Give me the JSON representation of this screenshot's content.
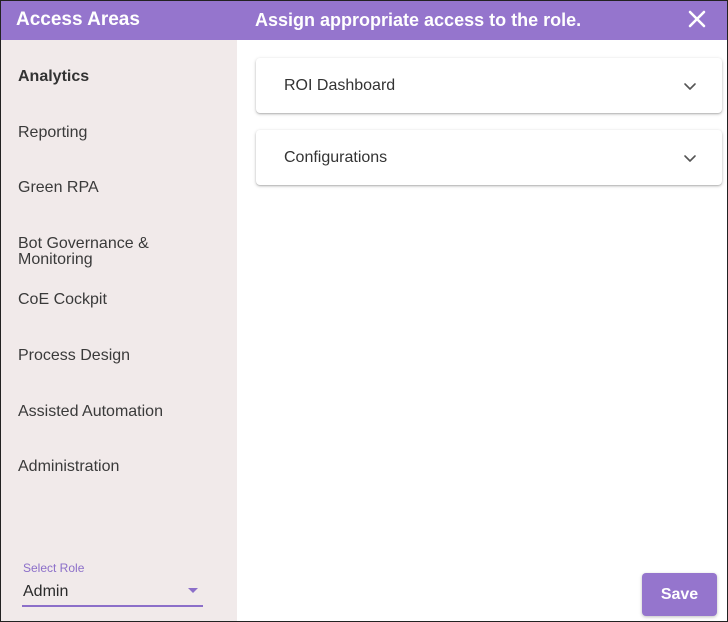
{
  "header": {
    "left_title": "Access Areas",
    "title": "Assign appropriate access to the role.",
    "close_icon": "close-icon"
  },
  "sidebar": {
    "items": [
      {
        "label": "Analytics",
        "active": true
      },
      {
        "label": "Reporting",
        "active": false
      },
      {
        "label": "Green RPA",
        "active": false
      },
      {
        "label": "Bot Governance & Monitoring",
        "active": false
      },
      {
        "label": "CoE Cockpit",
        "active": false
      },
      {
        "label": "Process Design",
        "active": false
      },
      {
        "label": "Assisted Automation",
        "active": false
      },
      {
        "label": "Administration",
        "active": false
      }
    ]
  },
  "role_select": {
    "label": "Select Role",
    "value": "Admin"
  },
  "main": {
    "panels": [
      {
        "label": "ROI Dashboard",
        "icon": "chevron-down-icon"
      },
      {
        "label": "Configurations",
        "icon": "chevron-down-icon"
      }
    ],
    "save_label": "Save"
  },
  "colors": {
    "accent": "#9575cd",
    "sidebar_bg": "#f1eaea"
  }
}
